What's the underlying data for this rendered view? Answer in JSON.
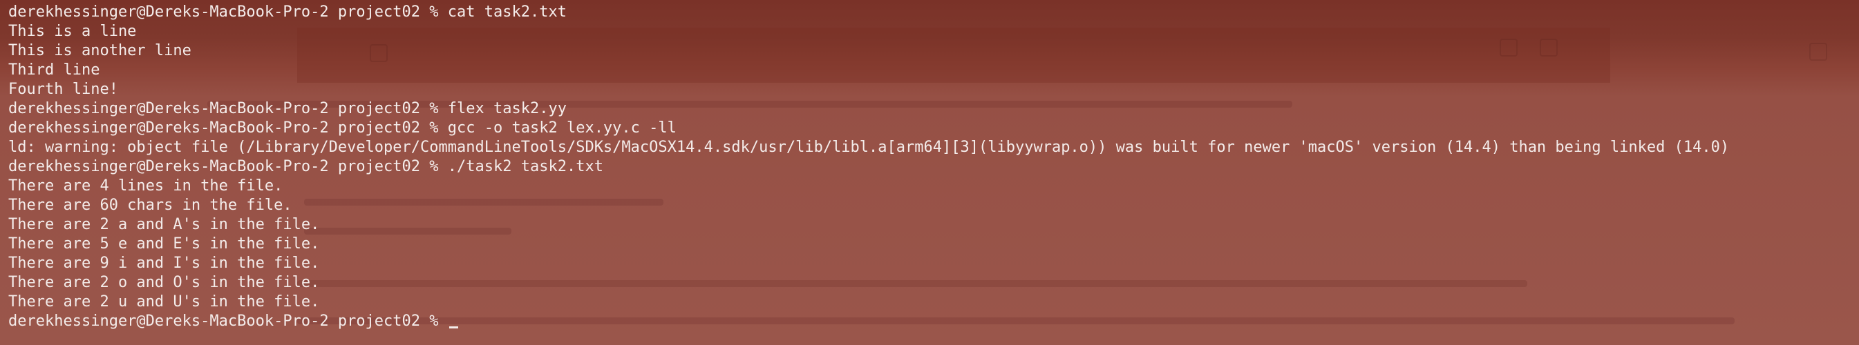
{
  "terminal": {
    "lines": [
      "derekhessinger@Dereks-MacBook-Pro-2 project02 % cat task2.txt",
      "This is a line",
      "This is another line",
      "Third line",
      "Fourth line!",
      "derekhessinger@Dereks-MacBook-Pro-2 project02 % flex task2.yy",
      "derekhessinger@Dereks-MacBook-Pro-2 project02 % gcc -o task2 lex.yy.c -ll",
      "ld: warning: object file (/Library/Developer/CommandLineTools/SDKs/MacOSX14.4.sdk/usr/lib/libl.a[arm64][3](libyywrap.o)) was built for newer 'macOS' version (14.4) than being linked (14.0)",
      "derekhessinger@Dereks-MacBook-Pro-2 project02 % ./task2 task2.txt",
      "There are 4 lines in the file.",
      "There are 60 chars in the file.",
      "There are 2 a and A's in the file.",
      "There are 5 e and E's in the file.",
      "There are 9 i and I's in the file.",
      "There are 2 o and O's in the file.",
      "There are 2 u and U's in the file.",
      "derekhessinger@Dereks-MacBook-Pro-2 project02 % "
    ]
  },
  "colors": {
    "background": "#9b574c",
    "text": "#f4ecea"
  }
}
